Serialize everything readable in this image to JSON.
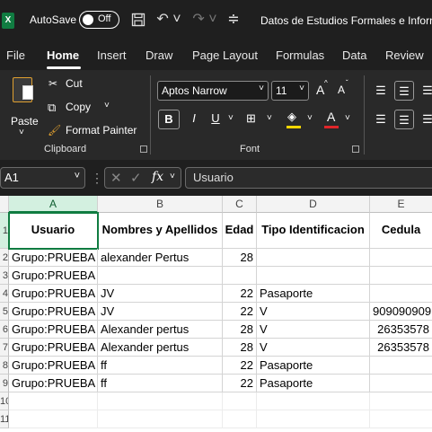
{
  "titlebar": {
    "logo": "X",
    "autosave_label": "AutoSave",
    "autosave_state": "Off",
    "doc_title": "Datos de Estudios Formales e Inform",
    "icons": [
      "save-icon",
      "undo-icon",
      "redo-icon",
      "customize-icon"
    ]
  },
  "menu": {
    "items": [
      "File",
      "Home",
      "Insert",
      "Draw",
      "Page Layout",
      "Formulas",
      "Data",
      "Review"
    ],
    "active": "Home"
  },
  "ribbon": {
    "clipboard": {
      "paste": "Paste",
      "cut": "Cut",
      "copy": "Copy",
      "format_painter": "Format Painter",
      "group_label": "Clipboard"
    },
    "font": {
      "font_name": "Aptos Narrow",
      "font_size": "11",
      "bold": "B",
      "italic": "I",
      "underline": "U",
      "grow": "A",
      "shrink": "A",
      "font_color": "A",
      "group_label": "Font"
    }
  },
  "formula_bar": {
    "name_box": "A1",
    "fx": "fx",
    "content": "Usuario"
  },
  "sheet": {
    "columns": [
      "A",
      "B",
      "C",
      "D",
      "E"
    ],
    "row_numbers": [
      "1",
      "2",
      "3",
      "4",
      "5",
      "6",
      "7",
      "8",
      "9",
      "10",
      "11"
    ],
    "headers": [
      "Usuario",
      "Nombres y Apellidos",
      "Edad",
      "Tipo Identificacion",
      "Cedula"
    ],
    "rows": [
      [
        "Grupo:PRUEBA",
        "alexander Pertus",
        "28",
        "",
        ""
      ],
      [
        "Grupo:PRUEBA",
        "",
        "",
        "",
        ""
      ],
      [
        "Grupo:PRUEBA",
        "JV",
        "22",
        "Pasaporte",
        ""
      ],
      [
        "Grupo:PRUEBA",
        "JV",
        "22",
        "V",
        "909090909"
      ],
      [
        "Grupo:PRUEBA",
        "Alexander pertus",
        "28",
        "V",
        "26353578"
      ],
      [
        "Grupo:PRUEBA",
        "Alexander pertus",
        "28",
        "V",
        "26353578"
      ],
      [
        "Grupo:PRUEBA",
        "ff",
        "22",
        "Pasaporte",
        ""
      ],
      [
        "Grupo:PRUEBA",
        "ff",
        "22",
        "Pasaporte",
        ""
      ]
    ],
    "selected_cell": "A1"
  },
  "colors": {
    "excel_green": "#107c41",
    "ribbon_bg": "#292929",
    "title_bg": "#1f1f1f"
  }
}
